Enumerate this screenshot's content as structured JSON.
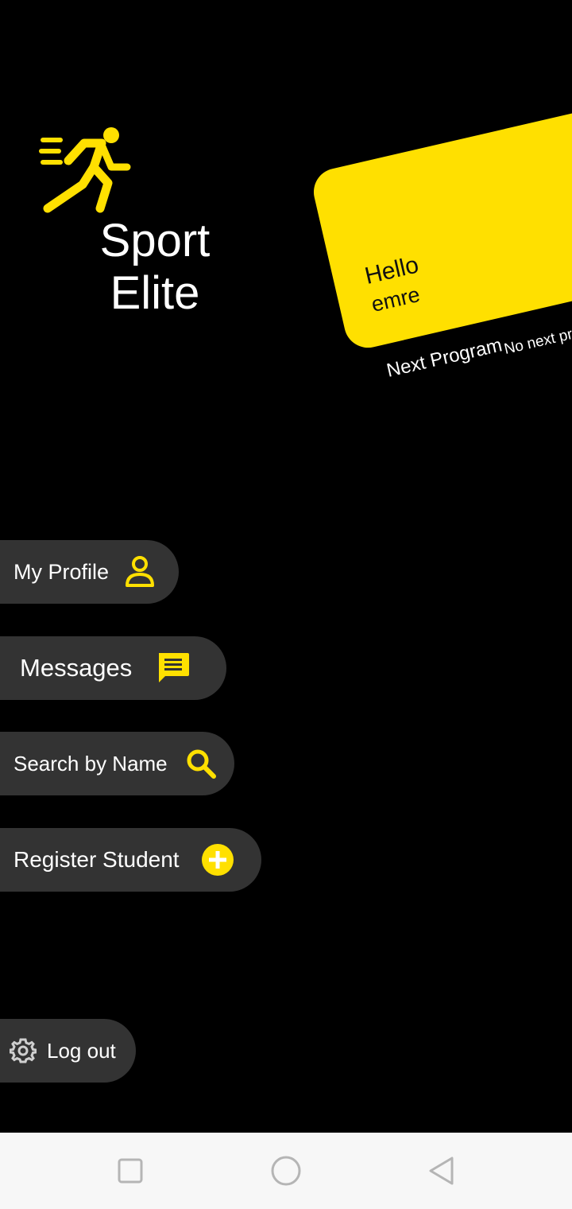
{
  "app": {
    "brand_line1": "Sport",
    "brand_line2": "Elite",
    "accent_color": "#FFE000"
  },
  "card": {
    "greeting": "Hello",
    "user_name": "emre",
    "next_program_title": "Next Program",
    "next_program_value": "No next program"
  },
  "menu": {
    "my_profile": {
      "label": "My Profile",
      "icon": "person-outline-icon"
    },
    "messages": {
      "label": "Messages",
      "icon": "message-icon"
    },
    "search": {
      "label": "Search by Name",
      "icon": "search-icon"
    },
    "register": {
      "label": "Register Student",
      "icon": "add-circle-icon"
    },
    "logout": {
      "label": "Log out",
      "icon": "gear-icon"
    }
  },
  "system_nav": [
    "recent-apps-icon",
    "home-icon",
    "back-icon"
  ]
}
